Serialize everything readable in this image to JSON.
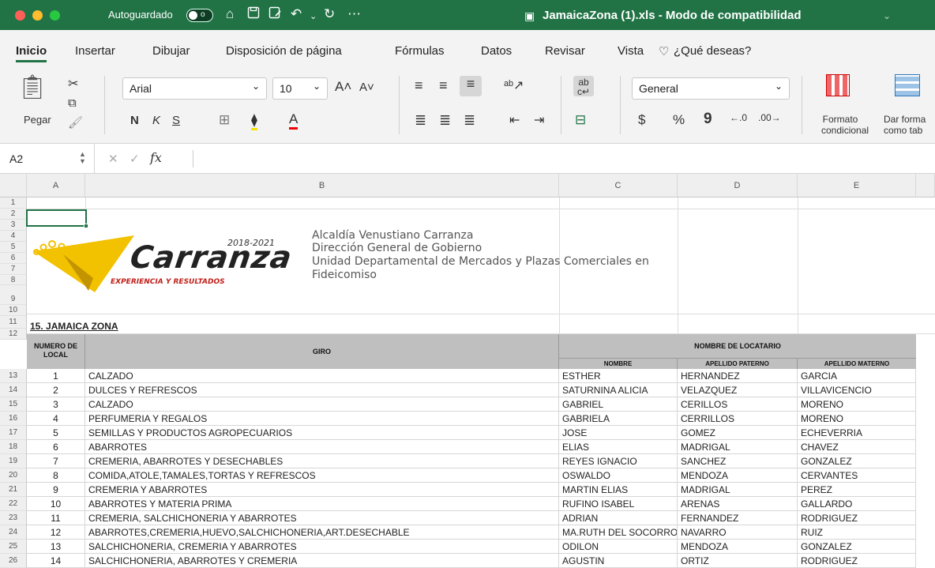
{
  "titlebar": {
    "autosave_label": "Autoguardado",
    "autosave_state": "o",
    "document_title": "JamaicaZona (1).xls  -  Modo de compatibilidad",
    "traffic_colors": [
      "#fe5f57",
      "#febc2e",
      "#28c840"
    ]
  },
  "tabs": [
    "Inicio",
    "Insertar",
    "Dibujar",
    "Disposición de página",
    "Fórmulas",
    "Datos",
    "Revisar",
    "Vista"
  ],
  "tell_me": "¿Qué deseas?",
  "ribbon": {
    "paste_label": "Pegar",
    "font_name": "Arial",
    "font_size": "10",
    "bold": "N",
    "italic": "K",
    "underline": "S",
    "number_format": "General",
    "currency": "$",
    "percent": "%",
    "comma": "9",
    "cond_format": [
      "Formato",
      "condicional"
    ],
    "table_format": [
      "Dar forma",
      "como tab"
    ]
  },
  "formula_bar": {
    "name_box": "A2",
    "fx": "fx",
    "value": ""
  },
  "columns": [
    "A",
    "B",
    "C",
    "D",
    "E"
  ],
  "logo": {
    "years": "2018-2021",
    "name": "Carranza",
    "slogan": "EXPERIENCIA Y RESULTADOS"
  },
  "org_lines": [
    "Alcaldía Venustiano Carranza",
    "Dirección General de Gobierno",
    "Unidad Departamental de Mercados y Plazas Comerciales en",
    "Fideicomiso"
  ],
  "sheet_title": "15. JAMAICA ZONA",
  "table_headers": {
    "numero": "NUMERO DE LOCAL",
    "giro": "GIRO",
    "locatario": "NOMBRE DE LOCATARIO",
    "nombre": "NOMBRE",
    "paterno": "APELLIDO PATERNO",
    "materno": "APELLIDO MATERNO"
  },
  "row_numbers": [
    "1",
    "2",
    "3",
    "4",
    "5",
    "6",
    "7",
    "8",
    "9",
    "10",
    "11",
    "12",
    "13",
    "14",
    "15",
    "16",
    "17",
    "18",
    "19",
    "20",
    "21",
    "22",
    "23",
    "24",
    "25",
    "26"
  ],
  "rows": [
    {
      "num": "1",
      "giro": "CALZADO",
      "nombre": "ESTHER",
      "paterno": "HERNANDEZ",
      "materno": "GARCIA"
    },
    {
      "num": "2",
      "giro": "DULCES Y REFRESCOS",
      "nombre": "SATURNINA ALICIA",
      "paterno": "VELAZQUEZ",
      "materno": "VILLAVICENCIO"
    },
    {
      "num": "3",
      "giro": "CALZADO",
      "nombre": "GABRIEL",
      "paterno": "CERILLOS",
      "materno": "MORENO"
    },
    {
      "num": "4",
      "giro": "PERFUMERIA Y REGALOS",
      "nombre": "GABRIELA",
      "paterno": "CERRILLOS",
      "materno": "MORENO"
    },
    {
      "num": "5",
      "giro": "SEMILLAS Y PRODUCTOS AGROPECUARIOS",
      "nombre": "JOSE",
      "paterno": "GOMEZ",
      "materno": "ECHEVERRIA"
    },
    {
      "num": "6",
      "giro": "ABARROTES",
      "nombre": "ELIAS",
      "paterno": "MADRIGAL",
      "materno": "CHAVEZ"
    },
    {
      "num": "7",
      "giro": "CREMERIA, ABARROTES Y DESECHABLES",
      "nombre": "REYES IGNACIO",
      "paterno": "SANCHEZ",
      "materno": "GONZALEZ"
    },
    {
      "num": "8",
      "giro": "COMIDA,ATOLE,TAMALES,TORTAS Y REFRESCOS",
      "nombre": "OSWALDO",
      "paterno": "MENDOZA",
      "materno": "CERVANTES"
    },
    {
      "num": "9",
      "giro": "CREMERIA Y ABARROTES",
      "nombre": "MARTIN ELIAS",
      "paterno": "MADRIGAL",
      "materno": "PEREZ"
    },
    {
      "num": "10",
      "giro": "ABARROTES Y MATERIA PRIMA",
      "nombre": "RUFINO ISABEL",
      "paterno": "ARENAS",
      "materno": "GALLARDO"
    },
    {
      "num": "11",
      "giro": "CREMERIA, SALCHICHONERIA Y ABARROTES",
      "nombre": "ADRIAN",
      "paterno": "FERNANDEZ",
      "materno": "RODRIGUEZ"
    },
    {
      "num": "12",
      "giro": "ABARROTES,CREMERIA,HUEVO,SALCHICHONERIA,ART.DESECHABLE",
      "nombre": "MA.RUTH DEL SOCORRO",
      "paterno": "NAVARRO",
      "materno": "RUIZ"
    },
    {
      "num": "13",
      "giro": "SALCHICHONERIA, CREMERIA Y ABARROTES",
      "nombre": "ODILON",
      "paterno": "MENDOZA",
      "materno": "GONZALEZ"
    },
    {
      "num": "14",
      "giro": "SALCHICHONERIA, ABARROTES Y CREMERIA",
      "nombre": "AGUSTIN",
      "paterno": "ORTIZ",
      "materno": "RODRIGUEZ"
    }
  ],
  "colors": {
    "accent": "#217346",
    "header_fill": "#bfbfbf",
    "logo_yellow": "#f2c100",
    "logo_red": "#c0201a"
  }
}
